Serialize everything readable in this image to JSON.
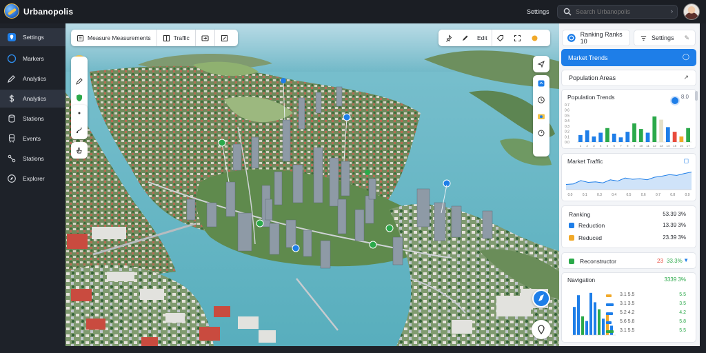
{
  "app": {
    "brand": "Urbanopolis"
  },
  "topbar": {
    "link_label": "Settings",
    "search_placeholder": "Search Urbanopolis",
    "search_value": ""
  },
  "sidebar": {
    "items": [
      {
        "label": "Settings",
        "icon": "location-pin-icon"
      },
      {
        "label": "Markers",
        "icon": "globe-icon"
      },
      {
        "label": "Analytics",
        "icon": "pencil-icon"
      },
      {
        "label": "Analytics",
        "icon": "dollar-icon"
      },
      {
        "label": "Stations",
        "icon": "cylinder-icon"
      },
      {
        "label": "Events",
        "icon": "transit-icon"
      },
      {
        "label": "Stations",
        "icon": "branch-icon"
      },
      {
        "label": "Explorer",
        "icon": "compass-icon"
      }
    ]
  },
  "map_toolbar": {
    "segments": [
      {
        "label": "Measure Measurements",
        "icon": "layers-icon"
      },
      {
        "label": "Traffic",
        "icon": "grid-icon"
      },
      {
        "label": "",
        "icon": "swap-icon"
      },
      {
        "label": "",
        "icon": "export-icon"
      }
    ]
  },
  "map_tools_right": {
    "group1": [
      "pin-tool-icon",
      "pen-tool-icon"
    ],
    "label": "Edit",
    "group2": [
      "tag-tool-icon",
      "fullscreen-icon",
      "gold-dot-icon"
    ]
  },
  "panel": {
    "header_left": "Ranking Ranks 10",
    "header_right": "Settings",
    "active_bar": "Market Trends",
    "section_title": "Population Areas",
    "card1": {
      "title": "Population Trends",
      "value": "8.0"
    },
    "card2": {
      "title": "Market Traffic"
    },
    "card3": {
      "title": "Ranking",
      "title_value": "53.39 3%",
      "rows": [
        {
          "label": "Reduction",
          "value": "13.39 3%",
          "color": "#1e7ee8"
        },
        {
          "label": "Reduced",
          "value": "23.39 3%",
          "color": "#f1a929"
        }
      ]
    },
    "card4": {
      "label": "Reconstructor",
      "value_red": "23",
      "value_green": "33.3%",
      "marker_color": "#2ba94a"
    },
    "card5": {
      "title": "Navigation",
      "title_value": "3339 3%",
      "rows": [
        {
          "label": "3.1 5.5",
          "value": "5.5"
        },
        {
          "label": "3.1 3.5",
          "value": "3.5"
        },
        {
          "label": "5.2 4.2",
          "value": "4.2"
        },
        {
          "label": "5.6 5.8",
          "value": "5.8"
        },
        {
          "label": "3.1 5.5",
          "value": "5.5"
        }
      ]
    }
  },
  "chart_data": [
    {
      "type": "bar",
      "title": "Population Trends",
      "ylabel": "",
      "ylim": [
        0,
        80
      ],
      "y_ticks": [
        "0.0",
        "0.1",
        "0.2",
        "0.3",
        "0.4",
        "0.5",
        "0.6",
        "0.7"
      ],
      "categories": [
        "1",
        "2",
        "3",
        "4",
        "5",
        "6",
        "7",
        "8",
        "9",
        "10",
        "11",
        "12",
        "13",
        "14",
        "15",
        "16",
        "17"
      ],
      "series": [
        {
          "values": [
            15,
            25,
            12,
            20,
            30,
            18,
            10,
            22,
            40,
            28,
            20,
            55,
            48,
            32,
            22,
            12,
            30
          ],
          "colors": [
            "#1e7ee8",
            "#1e7ee8",
            "#1e7ee8",
            "#1e7ee8",
            "#2ba94a",
            "#1e7ee8",
            "#1e7ee8",
            "#1e7ee8",
            "#2ba94a",
            "#2ba94a",
            "#1e7ee8",
            "#2ba94a",
            "#e5e0c8",
            "#1e7ee8",
            "#e84a3c",
            "#f1a929",
            "#2ba94a"
          ]
        }
      ]
    },
    {
      "type": "area",
      "title": "Market Traffic",
      "x": [
        "0.0",
        "0.1",
        "0.3",
        "0.4",
        "0.5",
        "0.6",
        "0.7",
        "0.8",
        "0.9"
      ],
      "values": [
        20,
        22,
        35,
        28,
        30,
        26,
        38,
        33,
        45,
        40,
        42,
        38,
        48,
        52,
        58,
        55,
        62,
        68
      ]
    },
    {
      "type": "bar",
      "title": "Navigation",
      "values": [
        60,
        85,
        40,
        30,
        90,
        70,
        55,
        35,
        45,
        20
      ],
      "colors": [
        "#1e7ee8",
        "#1e7ee8",
        "#2ba94a",
        "#1e7ee8",
        "#1e7ee8",
        "#1e7ee8",
        "#2ba94a",
        "#1e7ee8",
        "#f1a929",
        "#1e7ee8"
      ]
    }
  ],
  "legend_bars": {
    "values": [
      0.55,
      0.8,
      0.7,
      0.6,
      0.75
    ],
    "colors": [
      "#f1a929",
      "#1e7ee8",
      "#1e7ee8",
      "#1e7ee8",
      "#2ba94a"
    ]
  }
}
